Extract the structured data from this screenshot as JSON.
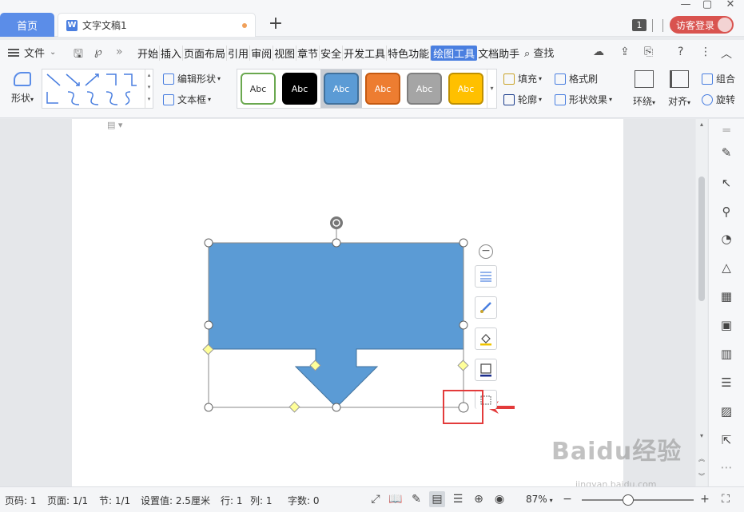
{
  "tabs": {
    "home_label": "首页",
    "doc_label": "文字文稿1",
    "doc_icon": "W",
    "add_label": "+",
    "window_badge": "1",
    "guest_label": "访客登录"
  },
  "menu": {
    "file_label": "文件",
    "items": [
      "开始",
      "插入",
      "页面布局",
      "引用",
      "审阅",
      "视图",
      "章节",
      "安全",
      "开发工具",
      "特色功能",
      "绘图工具",
      "文档助手"
    ],
    "active_item": "绘图工具",
    "search_label": "查找"
  },
  "ribbon": {
    "shape_label": "形状",
    "edit_shape_label": "编辑形状",
    "textbox_label": "文本框",
    "style_samples": [
      {
        "label": "Abc",
        "bg": "#ffffff",
        "border": "#6aa84f",
        "color": "#333333"
      },
      {
        "label": "Abc",
        "bg": "#000000",
        "border": "#000000",
        "color": "#ffffff"
      },
      {
        "label": "Abc",
        "bg": "#5b9bd5",
        "border": "#41719c",
        "color": "#ffffff"
      },
      {
        "label": "Abc",
        "bg": "#ed7d31",
        "border": "#c55a11",
        "color": "#ffffff"
      },
      {
        "label": "Abc",
        "bg": "#a5a5a5",
        "border": "#7f7f7f",
        "color": "#ffffff"
      },
      {
        "label": "Abc",
        "bg": "#ffc000",
        "border": "#bf9000",
        "color": "#ffffff"
      }
    ],
    "fill_label": "填充",
    "outline_label": "轮廓",
    "format_painter_label": "格式刷",
    "shape_effect_label": "形状效果",
    "wrap_label": "环绕",
    "align_label": "对齐",
    "group_label": "组合",
    "rotate_label": "旋转"
  },
  "shape": {
    "fill_color": "#5b9bd5",
    "border_color": "#41719c"
  },
  "status": {
    "page_no": "页码: 1",
    "page_of": "页面: 1/1",
    "section": "节: 1/1",
    "setting": "设置值: 2.5厘米",
    "row": "行: 1",
    "col": "列: 1",
    "words": "字数: 0",
    "zoom": "87%"
  },
  "watermark": {
    "brand": "Baidu经验",
    "url": "jingyan.baidu.com"
  },
  "colors": {
    "accent": "#4a7fe0",
    "highlight": "#e33b3b",
    "guest_button": "#d9534f"
  }
}
